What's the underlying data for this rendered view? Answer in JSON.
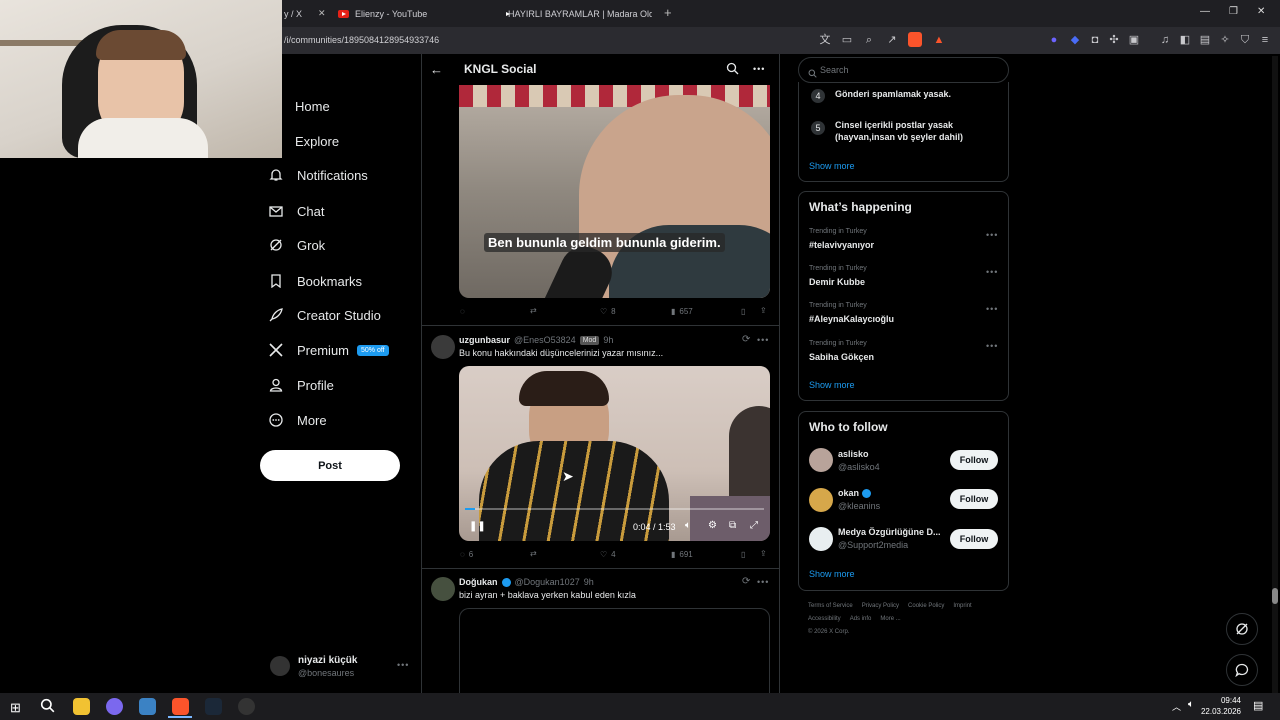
{
  "browser": {
    "tabs": [
      {
        "title": "y / X"
      },
      {
        "title": "Elienzy - YouTube"
      },
      {
        "title": "HAYIRLI BAYRAMLAR | Madara Olduk"
      }
    ],
    "url": "/i/communities/1895084128954933746",
    "new_tab_label": "+"
  },
  "nav": {
    "items": [
      {
        "label": "Home"
      },
      {
        "label": "Explore"
      },
      {
        "label": "Notifications"
      },
      {
        "label": "Chat"
      },
      {
        "label": "Grok"
      },
      {
        "label": "Bookmarks"
      },
      {
        "label": "Creator Studio"
      },
      {
        "label": "Premium"
      },
      {
        "label": "Profile"
      },
      {
        "label": "More"
      }
    ],
    "premium_badge": "50% off",
    "post_label": "Post",
    "account": {
      "name": "niyazi küçük",
      "handle": "@bonesaures"
    }
  },
  "header": {
    "title": "KNGL Social"
  },
  "post1": {
    "subtitle": "Ben bununla geldim bununla giderim.",
    "likes": "8",
    "views": "657"
  },
  "post2": {
    "name": "uzgunbasur",
    "handle": "@EnesO53824",
    "role": "Mod",
    "time": "9h",
    "text": "Bu konu hakkındaki düşüncelerinizi yazar mısınız...",
    "time_display": "0:04 / 1:53",
    "replies": "6",
    "likes": "4",
    "views": "691"
  },
  "post3": {
    "name": "Doğukan",
    "handle": "@Dogukan1027",
    "time": "9h",
    "text": "bizi ayran + baklava yerken kabul eden kızla"
  },
  "search": {
    "placeholder": "Search"
  },
  "rules": {
    "items": [
      {
        "num": "4",
        "text": "Gönderi spamlamak yasak."
      },
      {
        "num": "5",
        "text": "Cinsel içerikli postlar yasak (hayvan,insan vb şeyler dahil)"
      }
    ],
    "show_more": "Show more"
  },
  "trends": {
    "title": "What’s happening",
    "items": [
      {
        "category": "Trending in Turkey",
        "name": "#telavivyanıyor"
      },
      {
        "category": "Trending in Turkey",
        "name": "Demir Kubbe"
      },
      {
        "category": "Trending in Turkey",
        "name": "#AleynaKalaycıoğlu"
      },
      {
        "category": "Trending in Turkey",
        "name": "Sabiha Gökçen"
      }
    ],
    "show_more": "Show more"
  },
  "who_to_follow": {
    "title": "Who to follow",
    "items": [
      {
        "name": "aslisko",
        "handle": "@aslisko4",
        "verified": false
      },
      {
        "name": "okan",
        "handle": "@kleanins",
        "verified": true
      },
      {
        "name": "Medya Özgürlüğüne D...",
        "handle": "@Support2media",
        "verified": false
      }
    ],
    "follow_label": "Follow",
    "show_more": "Show more"
  },
  "footer": {
    "links": [
      "Terms of Service",
      "Privacy Policy",
      "Cookie Policy",
      "Imprint",
      "Accessibility",
      "Ads info",
      "More ..."
    ],
    "copyright": "© 2026 X Corp."
  },
  "taskbar": {
    "time": "09:44",
    "date": "22.03.2026"
  },
  "colors": {
    "accent": "#1d9bf0",
    "background": "#000000",
    "border": "#2f3336"
  }
}
